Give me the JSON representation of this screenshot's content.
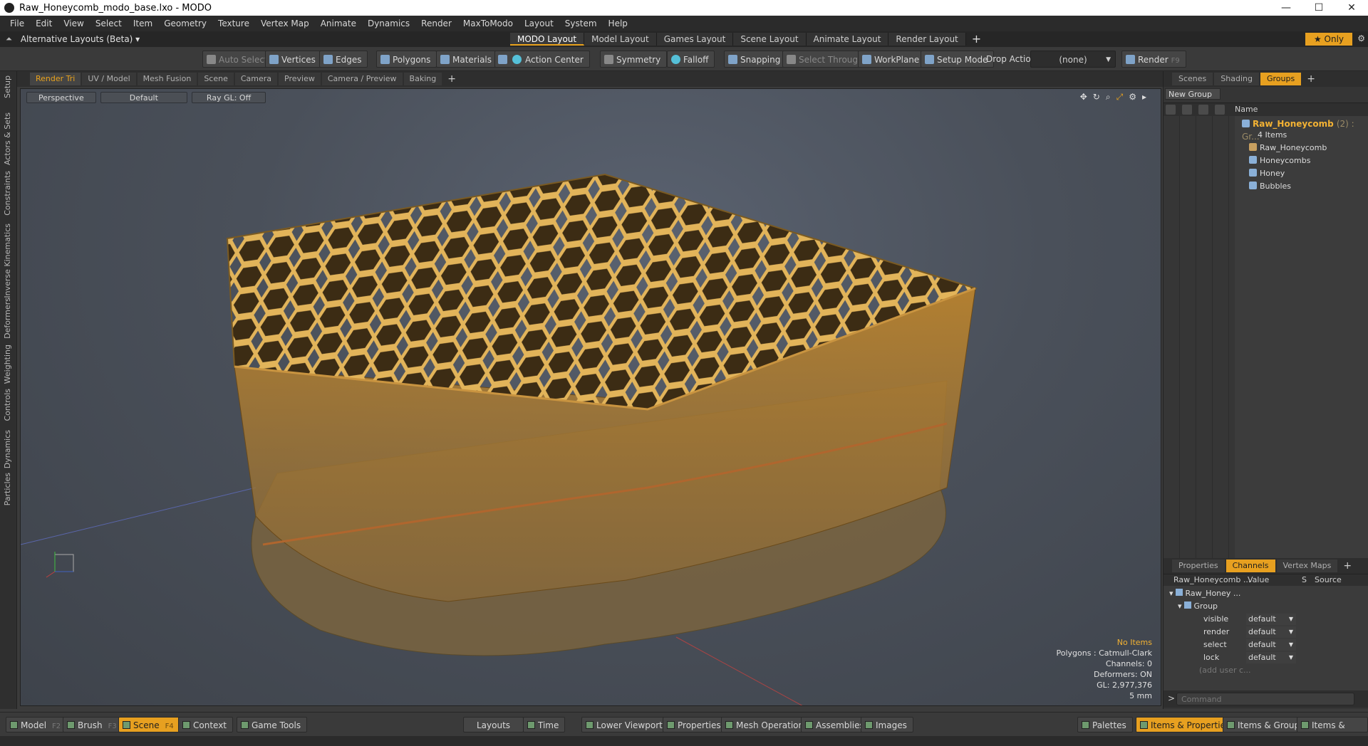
{
  "window": {
    "title": "Raw_Honeycomb_modo_base.lxo - MODO",
    "controls": [
      "—",
      "☐",
      "✕"
    ]
  },
  "menu": [
    "File",
    "Edit",
    "View",
    "Select",
    "Item",
    "Geometry",
    "Texture",
    "Vertex Map",
    "Animate",
    "Dynamics",
    "Render",
    "MaxToModo",
    "Layout",
    "System",
    "Help"
  ],
  "layouts": {
    "selector": "Alternative Layouts (Beta) ▾",
    "tabs": [
      "MODO Layout",
      "Model Layout",
      "Games Layout",
      "Scene Layout",
      "Animate Layout",
      "Render Layout"
    ],
    "active_tab": "MODO Layout",
    "add": "+",
    "only_label": "★  Only"
  },
  "toolbar": {
    "auto_select": "Auto Select",
    "vertices": "Vertices",
    "edges": "Edges",
    "polygons": "Polygons",
    "materials": "Materials",
    "action_center": "Action Center",
    "symmetry": "Symmetry",
    "falloff": "Falloff",
    "snapping": "Snapping",
    "select_through": "Select Through",
    "workplane": "WorkPlane",
    "setup_mode": "Setup Mode",
    "drop_action_label": "Drop Action",
    "drop_action_value": "(none)",
    "render": "Render",
    "render_key": "F9"
  },
  "left_strip": [
    "Setup",
    "Actors & Sets",
    "Constraints",
    "Inverse Kinematics",
    "Deformers",
    "Weighting",
    "Controls",
    "Dynamics",
    "Particles"
  ],
  "viewport_tabs": [
    "Render Tri",
    "UV / Model",
    "Mesh Fusion",
    "Scene",
    "Camera",
    "Preview",
    "Camera / Preview",
    "Baking"
  ],
  "viewport_tabs_active": "Render Tri",
  "viewport": {
    "view": "Perspective",
    "shading": "Default",
    "raygl": "Ray GL: Off",
    "info": {
      "items": "No Items",
      "polygons": "Polygons : Catmull-Clark",
      "channels": "Channels: 0",
      "deformers": "Deformers: ON",
      "gl": "GL: 2,977,376",
      "scale": "5 mm"
    }
  },
  "right_tabs": [
    "Scenes",
    "Shading",
    "Groups"
  ],
  "right_tabs_active": "Groups",
  "groups": {
    "new_group": "New Group",
    "column_name": "Name",
    "root": "Raw_Honeycomb",
    "root_count": "(2) : Gr...",
    "root_items": "4 Items",
    "children": [
      "Raw_Honeycomb",
      "Honeycombs",
      "Honey",
      "Bubbles"
    ]
  },
  "channel_tabs": [
    "Properties",
    "Channels",
    "Vertex Maps"
  ],
  "channel_tabs_active": "Channels",
  "channels": {
    "col_item": "Raw_Honeycomb ...",
    "col_value": "Value",
    "col_s": "S",
    "col_source": "Source",
    "item": "Raw_Honey ...",
    "group": "Group",
    "rows": [
      {
        "name": "visible",
        "value": "default"
      },
      {
        "name": "render",
        "value": "default"
      },
      {
        "name": "select",
        "value": "default"
      },
      {
        "name": "lock",
        "value": "default"
      }
    ],
    "add_user": "(add user c..."
  },
  "command": {
    "prompt": ">",
    "placeholder": "Command"
  },
  "bottom": {
    "model": "Model",
    "model_key": "F2",
    "brush": "Brush",
    "brush_key": "F3",
    "scene": "Scene",
    "scene_key": "F4",
    "context": "Context",
    "game_tools": "Game Tools",
    "layouts": "Layouts",
    "time": "Time",
    "lower_viewports": "Lower Viewports",
    "properties": "Properties",
    "mesh_operations": "Mesh Operations",
    "assemblies": "Assemblies",
    "images": "Images",
    "palettes": "Palettes",
    "items_properties": "Items & Properties",
    "items_groups": "Items & Groups",
    "items_shading": "Items & Shading"
  }
}
